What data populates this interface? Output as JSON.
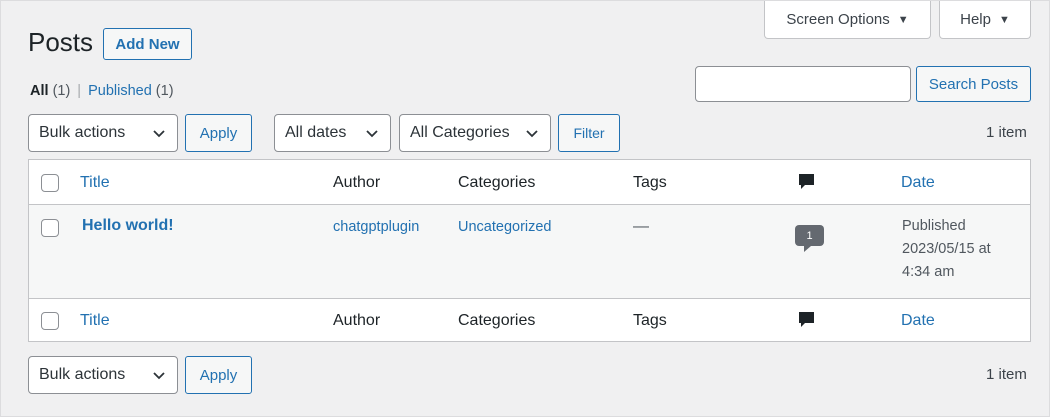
{
  "header": {
    "title": "Posts",
    "add_new_label": "Add New",
    "screen_options_label": "Screen Options",
    "help_label": "Help"
  },
  "views": {
    "all_label": "All",
    "all_count": "(1)",
    "separator": "|",
    "published_label": "Published",
    "published_count": "(1)"
  },
  "search": {
    "button_label": "Search Posts",
    "value": "",
    "placeholder": ""
  },
  "top_nav": {
    "bulk_actions": "Bulk actions",
    "apply_label": "Apply",
    "dates_filter": "All dates",
    "categories_filter": "All Categories",
    "filter_label": "Filter",
    "items_count": "1 item"
  },
  "table": {
    "columns": {
      "title": "Title",
      "author": "Author",
      "categories": "Categories",
      "tags": "Tags",
      "date": "Date"
    },
    "rows": [
      {
        "title": "Hello world!",
        "author": "chatgptplugin",
        "categories": "Uncategorized",
        "tags": "—",
        "comments": "1",
        "date_status": "Published",
        "date_value": "2023/05/15 at",
        "date_time": "4:34 am"
      }
    ]
  },
  "bottom_nav": {
    "bulk_actions": "Bulk actions",
    "apply_label": "Apply",
    "items_count": "1 item"
  },
  "icons": {
    "comments_column": "comment-icon",
    "dropdown": "chevron-down-icon",
    "tab_arrow": "triangle-down-icon"
  },
  "colors": {
    "link": "#2271b1",
    "background": "#f0f0f1",
    "comment_bubble": "#646970"
  }
}
